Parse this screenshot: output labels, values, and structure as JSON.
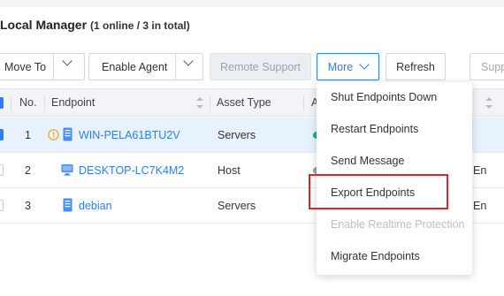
{
  "header": {
    "title": "Local Manager",
    "summary": "(1 online / 3 in total)"
  },
  "toolbar": {
    "move_to": "Move To",
    "enable_agent": "Enable Agent",
    "remote_support": "Remote Support",
    "more": "More",
    "refresh": "Refresh",
    "search_placeholder": "Supp"
  },
  "table": {
    "columns": [
      "No.",
      "Endpoint",
      "Asset Type",
      "A"
    ],
    "rows": [
      {
        "no": "1",
        "endpoint": "WIN-PELA61BTU2V",
        "asset_type": "Servers",
        "icon": "server-icon",
        "warning": true,
        "selected": true
      },
      {
        "no": "2",
        "endpoint": "DESKTOP-LC7K4M2",
        "asset_type": "Host",
        "icon": "monitor-icon",
        "warning": false,
        "selected": false,
        "trail": "En"
      },
      {
        "no": "3",
        "endpoint": "debian",
        "asset_type": "Servers",
        "icon": "server-icon",
        "warning": false,
        "selected": false,
        "trail": "En"
      }
    ]
  },
  "more_menu": {
    "items": [
      {
        "label": "Shut Endpoints Down",
        "enabled": true
      },
      {
        "label": "Restart Endpoints",
        "enabled": true
      },
      {
        "label": "Send Message",
        "enabled": true
      },
      {
        "label": "Export Endpoints",
        "enabled": true,
        "highlighted": true
      },
      {
        "label": "Enable Realtime Protection",
        "enabled": false
      },
      {
        "label": "Migrate Endpoints",
        "enabled": true
      }
    ]
  },
  "colors": {
    "accent": "#2f7cf6",
    "highlight_box": "#d9262c",
    "online_dot": "#22b573",
    "warning": "#f5a623"
  }
}
